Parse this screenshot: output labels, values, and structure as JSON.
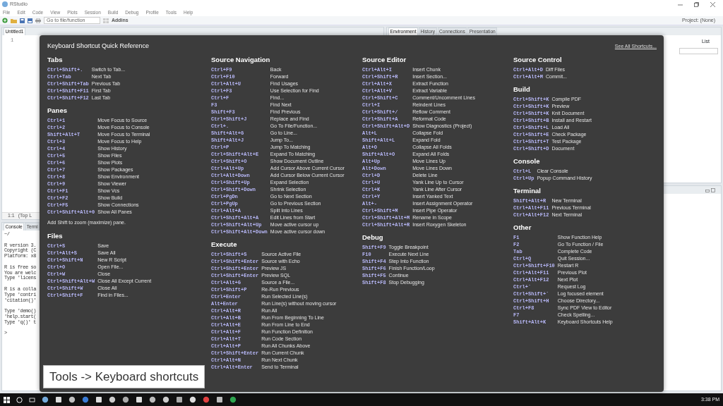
{
  "window": {
    "title": "RStudio"
  },
  "menu": [
    "File",
    "Edit",
    "Code",
    "View",
    "Plots",
    "Session",
    "Build",
    "Debug",
    "Profile",
    "Tools",
    "Help"
  ],
  "toolbar": {
    "goto_placeholder": "Go to file/function",
    "addins": "Addins",
    "project": "Project: (None)"
  },
  "editor": {
    "tab": "Untitled1",
    "line_number": "1",
    "position": "1:1",
    "scope": "(Top L"
  },
  "console": {
    "tabs": [
      {
        "label": "Console",
        "selected": true
      },
      {
        "label": "Termi",
        "selected": false
      }
    ],
    "path": "~/",
    "paragraphs": [
      [
        "R version 3.",
        "Copyright (C",
        "Platform: x8"
      ],
      [
        "R is free so",
        "You are welc",
        "Type 'licens"
      ],
      [
        "R is a colla",
        "Type 'contri",
        "'citation()'"
      ],
      [
        "Type 'demo()",
        "'help.start(",
        "Type 'q()' t"
      ],
      [
        ">"
      ]
    ]
  },
  "right_pane": {
    "tabs": [
      {
        "label": "Environment",
        "selected": true
      },
      {
        "label": "History",
        "selected": false
      },
      {
        "label": "Connections",
        "selected": false
      },
      {
        "label": "Presentation",
        "selected": false
      }
    ],
    "view_button": "List"
  },
  "shortcuts": {
    "title": "Keyboard Shortcut Quick Reference",
    "link": "See All Shortcuts...",
    "columns": [
      {
        "sections": [
          {
            "title": "Tabs",
            "rows": [
              {
                "key": "Ctrl+Shift+.",
                "action": "Switch to Tab..."
              },
              {
                "key": "Ctrl+Tab",
                "action": "Next Tab"
              },
              {
                "key": "Ctrl+Shift+Tab",
                "action": "Previous Tab"
              },
              {
                "key": "Ctrl+Shift+F11",
                "action": "First Tab"
              },
              {
                "key": "Ctrl+Shift+F12",
                "action": "Last Tab"
              }
            ]
          },
          {
            "title": "Panes",
            "rows": [
              {
                "key": "Ctrl+1",
                "action": "Move Focus to Source"
              },
              {
                "key": "Ctrl+2",
                "action": "Move Focus to Console"
              },
              {
                "key": "Shift+Alt+T",
                "action": "Move Focus to Terminal"
              },
              {
                "key": "Ctrl+3",
                "action": "Move Focus to Help"
              },
              {
                "key": "Ctrl+4",
                "action": "Show History"
              },
              {
                "key": "Ctrl+5",
                "action": "Show Files"
              },
              {
                "key": "Ctrl+6",
                "action": "Show Plots"
              },
              {
                "key": "Ctrl+7",
                "action": "Show Packages"
              },
              {
                "key": "Ctrl+8",
                "action": "Show Environment"
              },
              {
                "key": "Ctrl+9",
                "action": "Show Viewer"
              },
              {
                "key": "Ctrl+F1",
                "action": "Show Vcs"
              },
              {
                "key": "Ctrl+F2",
                "action": "Show Build"
              },
              {
                "key": "Ctrl+F5",
                "action": "Show Connections"
              },
              {
                "key": "Ctrl+Shift+Alt+0",
                "action": "Show All Panes"
              }
            ],
            "note": "Add Shift to zoom (maximize) pane."
          },
          {
            "title": "Files",
            "rows": [
              {
                "key": "Ctrl+S",
                "action": "Save"
              },
              {
                "key": "Ctrl+Alt+S",
                "action": "Save All"
              },
              {
                "key": "Ctrl+Shift+N",
                "action": "New R Script"
              },
              {
                "key": "Ctrl+O",
                "action": "Open File..."
              },
              {
                "key": "Ctrl+W",
                "action": "Close"
              },
              {
                "key": "Ctrl+Shift+Alt+W",
                "action": "Close All Except Current"
              },
              {
                "key": "Ctrl+Shift+W",
                "action": "Close All"
              },
              {
                "key": "Ctrl+Shift+F",
                "action": "Find in Files..."
              }
            ]
          }
        ]
      },
      {
        "sections": [
          {
            "title": "Source Navigation",
            "rows": [
              {
                "key": "Ctrl+F9",
                "action": "Back"
              },
              {
                "key": "Ctrl+F10",
                "action": "Forward"
              },
              {
                "key": "Ctrl+Alt+U",
                "action": "Find Usages"
              },
              {
                "key": "Ctrl+F3",
                "action": "Use Selection for Find"
              },
              {
                "key": "Ctrl+F",
                "action": "Find..."
              },
              {
                "key": "F3",
                "action": "Find Next"
              },
              {
                "key": "Shift+F3",
                "action": "Find Previous"
              },
              {
                "key": "Ctrl+Shift+J",
                "action": "Replace and Find"
              },
              {
                "key": "Ctrl+.",
                "action": "Go To File/Function..."
              },
              {
                "key": "Shift+Alt+G",
                "action": "Go to Line..."
              },
              {
                "key": "Shift+Alt+J",
                "action": "Jump To..."
              },
              {
                "key": "Ctrl+P",
                "action": "Jump To Matching"
              },
              {
                "key": "Ctrl+Shift+Alt+E",
                "action": "Expand To Matching"
              },
              {
                "key": "Ctrl+Shift+O",
                "action": "Show Document Outline"
              },
              {
                "key": "Ctrl+Alt+Up",
                "action": "Add Cursor Above Current Cursor"
              },
              {
                "key": "Ctrl+Alt+Down",
                "action": "Add Cursor Below Current Cursor"
              },
              {
                "key": "Ctrl+Shift+Up",
                "action": "Expand Selection"
              },
              {
                "key": "Ctrl+Shift+Down",
                "action": "Shrink Selection"
              },
              {
                "key": "Ctrl+PgDn",
                "action": "Go to Next Section"
              },
              {
                "key": "Ctrl+PgUp",
                "action": "Go to Previous Section"
              },
              {
                "key": "Ctrl+Alt+A",
                "action": "Split Into Lines"
              },
              {
                "key": "Ctrl+Shift+Alt+A",
                "action": "Edit Lines from Start"
              },
              {
                "key": "Ctrl+Shift+Alt+Up",
                "action": "Move active cursor up"
              },
              {
                "key": "Ctrl+Shift+Alt+Down",
                "action": "Move active cursor down"
              }
            ]
          },
          {
            "title": "Execute",
            "rows": [
              {
                "key": "Ctrl+Shift+S",
                "action": "Source Active File"
              },
              {
                "key": "Ctrl+Shift+Enter",
                "action": "Source with Echo"
              },
              {
                "key": "Ctrl+Shift+Enter",
                "action": "Preview JS"
              },
              {
                "key": "Ctrl+Shift+Enter",
                "action": "Preview SQL"
              },
              {
                "key": "Ctrl+Alt+G",
                "action": "Source a File..."
              },
              {
                "key": "Ctrl+Shift+P",
                "action": "Re-Run Previous"
              },
              {
                "key": "Ctrl+Enter",
                "action": "Run Selected Line(s)"
              },
              {
                "key": "Alt+Enter",
                "action": "Run Line(s) without moving cursor"
              },
              {
                "key": "Ctrl+Alt+R",
                "action": "Run All"
              },
              {
                "key": "Ctrl+Alt+B",
                "action": "Run From Beginning To Line"
              },
              {
                "key": "Ctrl+Alt+E",
                "action": "Run From Line to End"
              },
              {
                "key": "Ctrl+Alt+F",
                "action": "Run Function Definition"
              },
              {
                "key": "Ctrl+Alt+T",
                "action": "Run Code Section"
              },
              {
                "key": "Ctrl+Alt+P",
                "action": "Run All Chunks Above"
              },
              {
                "key": "Ctrl+Shift+Enter",
                "action": "Run Current Chunk"
              },
              {
                "key": "Ctrl+Alt+N",
                "action": "Run Next Chunk"
              },
              {
                "key": "Ctrl+Alt+Enter",
                "action": "Send to Terminal"
              }
            ]
          }
        ]
      },
      {
        "sections": [
          {
            "title": "Source Editor",
            "rows": [
              {
                "key": "Ctrl+Alt+I",
                "action": "Insert Chunk"
              },
              {
                "key": "Ctrl+Shift+R",
                "action": "Insert Section..."
              },
              {
                "key": "Ctrl+Alt+X",
                "action": "Extract Function"
              },
              {
                "key": "Ctrl+Alt+V",
                "action": "Extract Variable"
              },
              {
                "key": "Ctrl+Shift+C",
                "action": "Comment/Uncomment Lines"
              },
              {
                "key": "Ctrl+I",
                "action": "Reindent Lines"
              },
              {
                "key": "Ctrl+Shift+/",
                "action": "Reflow Comment"
              },
              {
                "key": "Ctrl+Shift+A",
                "action": "Reformat Code"
              },
              {
                "key": "Ctrl+Shift+Alt+D",
                "action": "Show Diagnostics (Project)"
              },
              {
                "key": "Alt+L",
                "action": "Collapse Fold"
              },
              {
                "key": "Shift+Alt+L",
                "action": "Expand Fold"
              },
              {
                "key": "Alt+O",
                "action": "Collapse All Folds"
              },
              {
                "key": "Shift+Alt+O",
                "action": "Expand All Folds"
              },
              {
                "key": "Alt+Up",
                "action": "Move Lines Up"
              },
              {
                "key": "Alt+Down",
                "action": "Move Lines Down"
              },
              {
                "key": "Ctrl+D",
                "action": "Delete Line"
              },
              {
                "key": "Ctrl+U",
                "action": "Yank Line Up to Cursor"
              },
              {
                "key": "Ctrl+K",
                "action": "Yank Line After Cursor"
              },
              {
                "key": "Ctrl+Y",
                "action": "Insert Yanked Text"
              },
              {
                "key": "Alt+-",
                "action": "Insert Assignment Operator"
              },
              {
                "key": "Ctrl+Shift+M",
                "action": "Insert Pipe Operator"
              },
              {
                "key": "Ctrl+Shift+Alt+M",
                "action": "Rename in Scope"
              },
              {
                "key": "Ctrl+Shift+Alt+R",
                "action": "Insert Roxygen Skeleton"
              }
            ]
          },
          {
            "title": "Debug",
            "rows": [
              {
                "key": "Shift+F9",
                "action": "Toggle Breakpoint"
              },
              {
                "key": "F10",
                "action": "Execute Next Line"
              },
              {
                "key": "Shift+F4",
                "action": "Step Into Function"
              },
              {
                "key": "Shift+F6",
                "action": "Finish Function/Loop"
              },
              {
                "key": "Shift+F5",
                "action": "Continue"
              },
              {
                "key": "Shift+F8",
                "action": "Stop Debugging"
              }
            ]
          }
        ]
      },
      {
        "sections": [
          {
            "title": "Source Control",
            "rows": [
              {
                "key": "Ctrl+Alt+D",
                "action": "Diff Files"
              },
              {
                "key": "Ctrl+Alt+M",
                "action": "Commit..."
              }
            ]
          },
          {
            "title": "Build",
            "rows": [
              {
                "key": "Ctrl+Shift+K",
                "action": "Compile PDF"
              },
              {
                "key": "Ctrl+Shift+K",
                "action": "Preview"
              },
              {
                "key": "Ctrl+Shift+K",
                "action": "Knit Document"
              },
              {
                "key": "Ctrl+Shift+B",
                "action": "Install and Restart"
              },
              {
                "key": "Ctrl+Shift+L",
                "action": "Load All"
              },
              {
                "key": "Ctrl+Shift+E",
                "action": "Check Package"
              },
              {
                "key": "Ctrl+Shift+T",
                "action": "Test Package"
              },
              {
                "key": "Ctrl+Shift+D",
                "action": "Document"
              }
            ]
          },
          {
            "title": "Console",
            "rows": [
              {
                "key": "Ctrl+L",
                "action": "Clear Console"
              },
              {
                "key": "Ctrl+Up",
                "action": "Popup Command History"
              }
            ]
          },
          {
            "title": "Terminal",
            "rows": [
              {
                "key": "Shift+Alt+R",
                "action": "New Terminal"
              },
              {
                "key": "Ctrl+Alt+F11",
                "action": "Previous Terminal"
              },
              {
                "key": "Ctrl+Alt+F12",
                "action": "Next Terminal"
              }
            ]
          },
          {
            "title": "Other",
            "rows": [
              {
                "key": "F1",
                "action": "Show Function Help"
              },
              {
                "key": "F2",
                "action": "Go To Function / File"
              },
              {
                "key": "Tab",
                "action": "Complete Code"
              },
              {
                "key": "Ctrl+Q",
                "action": "Quit Session..."
              },
              {
                "key": "Ctrl+Shift+F10",
                "action": "Restart R"
              },
              {
                "key": "Ctrl+Alt+F11",
                "action": "Previous Plot"
              },
              {
                "key": "Ctrl+Alt+F12",
                "action": "Next Plot"
              },
              {
                "key": "Ctrl+`",
                "action": "Request Log"
              },
              {
                "key": "Ctrl+Shift+`",
                "action": "Log focused element"
              },
              {
                "key": "Ctrl+Shift+H",
                "action": "Choose Directory..."
              },
              {
                "key": "Ctrl+F8",
                "action": "Sync PDF View to Editor"
              },
              {
                "key": "F7",
                "action": "Check Spelling..."
              },
              {
                "key": "Shift+Alt+K",
                "action": "Keyboard Shortcuts Help"
              }
            ]
          }
        ]
      }
    ]
  },
  "caption": "Tools -> Keyboard shortcuts",
  "taskbar": {
    "time": "3:38 PM"
  }
}
